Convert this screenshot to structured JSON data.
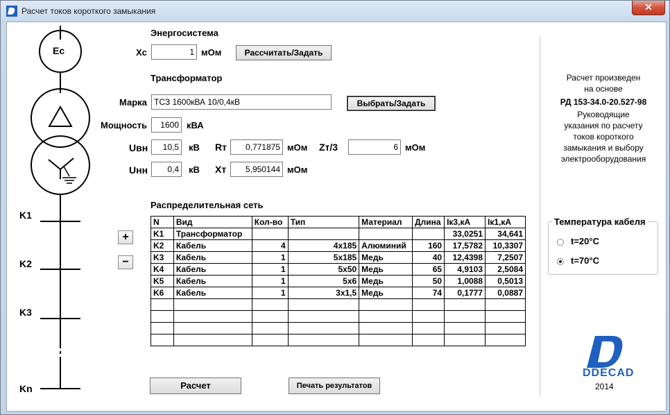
{
  "window": {
    "title": "Расчет токов короткого замыкания",
    "close_symbol": "✕"
  },
  "scheme": {
    "source_label": "Ec",
    "nodes": [
      "K1",
      "K2",
      "K3",
      "Kn"
    ]
  },
  "energy": {
    "heading": "Энергосистема",
    "xc_label": "Xc",
    "xc_value": "1",
    "xc_unit": "мОм",
    "calc_button": "Рассчитать/Задать"
  },
  "transformer": {
    "heading": "Трансформатор",
    "brand_label": "Марка",
    "brand_value": "ТСЗ 1600кВА 10/0,4кВ",
    "select_button": "Выбрать/Задать",
    "power_label": "Мощность",
    "power_value": "1600",
    "power_unit": "кВА",
    "uvn_label": "Uвн",
    "uvn_value": "10,5",
    "uvn_unit": "кВ",
    "unn_label": "Uнн",
    "unn_value": "0,4",
    "unn_unit": "кВ",
    "rt_label": "Rт",
    "rt_value": "0,771875",
    "rt_unit": "мОм",
    "xt_label": "Xт",
    "xt_value": "5,950144",
    "xt_unit": "мОм",
    "zt_label": "Zт/3",
    "zt_value": "6",
    "zt_unit": "мОм"
  },
  "network": {
    "heading": "Распределительная сеть",
    "add_symbol": "+",
    "remove_symbol": "−",
    "columns": [
      "N",
      "Вид",
      "Кол-во",
      "Тип",
      "Материал",
      "Длина",
      "Iк3,кА",
      "Iк1,кА"
    ],
    "rows": [
      [
        "K1",
        "Трансформатор",
        "",
        "",
        "",
        "",
        "33,0251",
        "34,641"
      ],
      [
        "K2",
        "Кабель",
        "4",
        "4x185",
        "Алюминий",
        "160",
        "17,5782",
        "10,3307"
      ],
      [
        "K3",
        "Кабель",
        "1",
        "5x185",
        "Медь",
        "40",
        "12,4398",
        "7,2507"
      ],
      [
        "K4",
        "Кабель",
        "1",
        "5x50",
        "Медь",
        "65",
        "4,9103",
        "2,5084"
      ],
      [
        "K5",
        "Кабель",
        "1",
        "5x6",
        "Медь",
        "50",
        "1,0088",
        "0,5013"
      ],
      [
        "K6",
        "Кабель",
        "1",
        "3x1,5",
        "Медь",
        "74",
        "0,1777",
        "0,0887"
      ],
      [
        "",
        "",
        "",
        "",
        "",
        "",
        "",
        ""
      ],
      [
        "",
        "",
        "",
        "",
        "",
        "",
        "",
        ""
      ],
      [
        "",
        "",
        "",
        "",
        "",
        "",
        "",
        ""
      ],
      [
        "",
        "",
        "",
        "",
        "",
        "",
        "",
        ""
      ]
    ]
  },
  "actions": {
    "calc_button": "Расчет",
    "print_button": "Печать результатов"
  },
  "info": {
    "line1": "Расчет произведен",
    "line2": "на основе",
    "standard": "РД 153-34.0-20.527-98",
    "guide": [
      "Руководящие",
      "указания по расчету",
      "токов короткого",
      "замыкания и выбору",
      "электрооборудования"
    ]
  },
  "temperature": {
    "title": "Температура кабеля",
    "opt1": "t=20°C",
    "opt2": "t=70°C",
    "selected": "t=70°C"
  },
  "logo": {
    "text": "DDECAD",
    "year": "2014",
    "color": "#1f5fbf"
  }
}
